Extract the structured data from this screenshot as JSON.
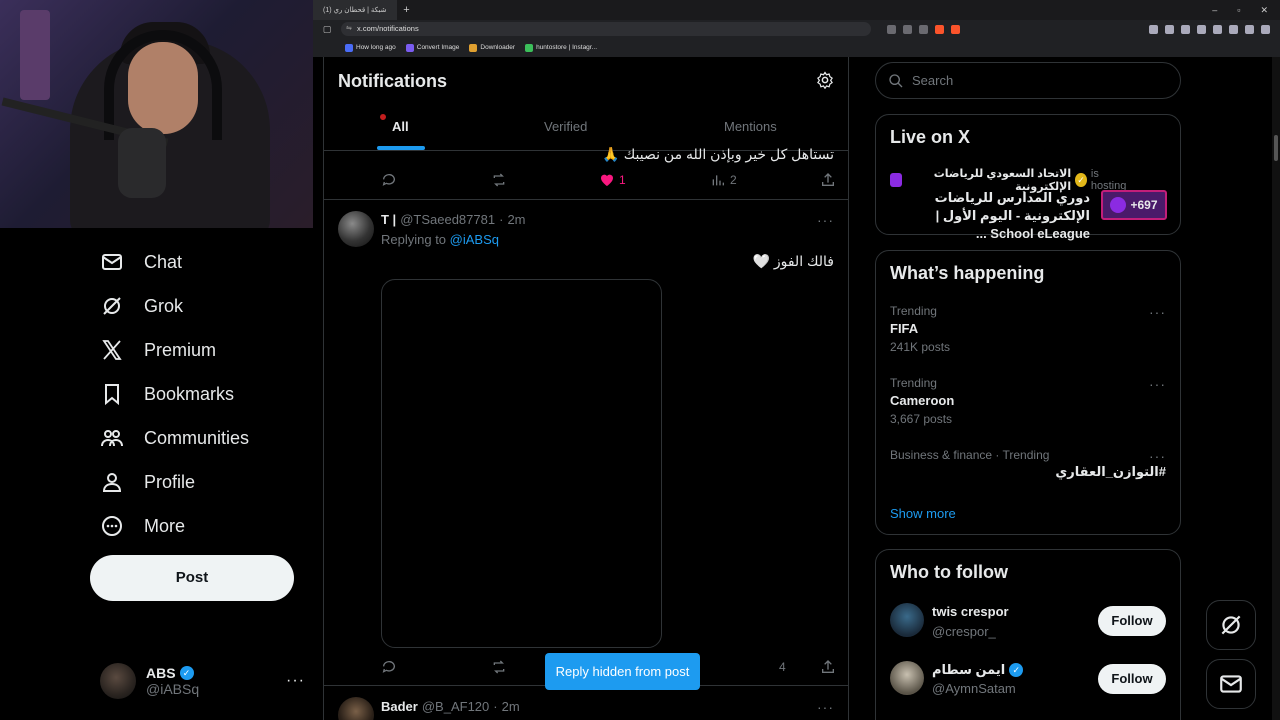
{
  "browser": {
    "tab_title": "(1) شبكة | قحطان ري",
    "url": "x.com/notifications",
    "bookmarks": [
      {
        "label": "How long ago",
        "color": "#4a6cf7"
      },
      {
        "label": "Convert Image",
        "color": "#7a5cf0"
      },
      {
        "label": "Downloader",
        "color": "#e0a030"
      },
      {
        "label": "huntostore | Instagr...",
        "color": "#3bbf5a"
      }
    ]
  },
  "nav": {
    "items": [
      {
        "label": "Chat",
        "icon": "mail-icon"
      },
      {
        "label": "Grok",
        "icon": "grok-icon"
      },
      {
        "label": "Premium",
        "icon": "x-logo-icon"
      },
      {
        "label": "Bookmarks",
        "icon": "bookmark-icon"
      },
      {
        "label": "Communities",
        "icon": "communities-icon"
      },
      {
        "label": "Profile",
        "icon": "profile-icon"
      },
      {
        "label": "More",
        "icon": "more-circle-icon"
      }
    ],
    "post_label": "Post"
  },
  "account": {
    "name": "ABS",
    "handle": "@iABSq"
  },
  "notifications": {
    "title": "Notifications",
    "tabs": [
      {
        "label": "All",
        "active": true
      },
      {
        "label": "Verified",
        "active": false
      },
      {
        "label": "Mentions",
        "active": false
      }
    ],
    "partial_tweet": {
      "text": "تستاهل كل خير وبإذن الله من نصيبك 🙏",
      "likes": "1",
      "views": "2"
    },
    "tweet": {
      "name": "T |",
      "handle": "@TSaeed87781",
      "time": "2m",
      "replying_label": "Replying to",
      "replying_to": "@iABSq",
      "text": "فالك الفوز 🤍",
      "views": "4"
    },
    "next_tweet": {
      "name": "Bader",
      "handle": "@B_AF120",
      "time": "2m"
    },
    "toast": "Reply hidden from post"
  },
  "sidebar_right": {
    "search_placeholder": "Search",
    "live": {
      "title": "Live on X",
      "host": "الاتحاد السعودي للرياضات الإلكترونية",
      "hosting_label": "is hosting",
      "event": "دوري المدارس للرياضات الإلكترونية - اليوم الأول | School eLeague ...",
      "listeners": "+697"
    },
    "happening": {
      "title": "What’s happening",
      "trends": [
        {
          "category": "Trending",
          "name": "FIFA",
          "count": "241K posts"
        },
        {
          "category": "Trending",
          "name": "Cameroon",
          "count": "3,667 posts"
        },
        {
          "category": "Business & finance · Trending",
          "name": "#التوازن_العقاري",
          "count": ""
        }
      ],
      "show_more": "Show more"
    },
    "who_to_follow": {
      "title": "Who to follow",
      "users": [
        {
          "name": "twis crespor",
          "handle": "@crespor_",
          "verified": false
        },
        {
          "name": "ايمن سطام",
          "handle": "@AymnSatam",
          "verified": true
        }
      ],
      "follow_label": "Follow"
    }
  },
  "colors": {
    "accent": "#1d9bf0",
    "like": "#f91880",
    "background": "#000000"
  }
}
